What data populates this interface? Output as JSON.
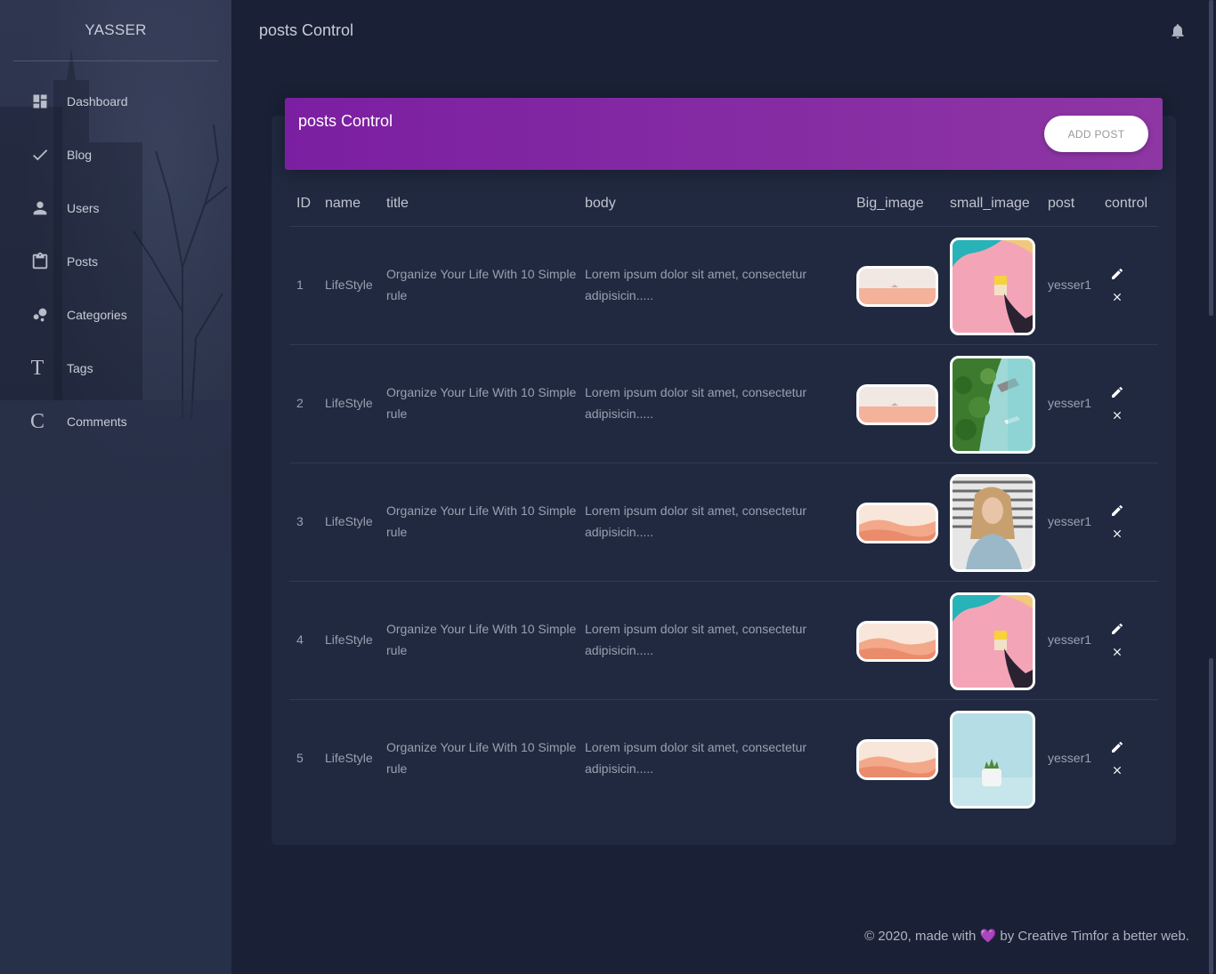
{
  "sidebar": {
    "brand": "YASSER",
    "items": [
      {
        "label": "Dashboard",
        "icon": "dashboard-icon"
      },
      {
        "label": "Blog",
        "icon": "check-icon"
      },
      {
        "label": "Users",
        "icon": "person-icon"
      },
      {
        "label": "Posts",
        "icon": "clipboard-icon"
      },
      {
        "label": "Categories",
        "icon": "bubble-chart-icon"
      },
      {
        "label": "Tags",
        "icon": "letter-t-icon",
        "letter": "T"
      },
      {
        "label": "Comments",
        "icon": "letter-c-icon",
        "letter": "C"
      }
    ]
  },
  "header": {
    "title": "posts Control"
  },
  "card": {
    "title": "posts Control",
    "add_button": "ADD POST",
    "columns": [
      "ID",
      "name",
      "title",
      "body",
      "Big_image",
      "small_image",
      "post",
      "control"
    ],
    "rows": [
      {
        "id": "1",
        "name": "LifeStyle",
        "title": "Organize Your Life With 10 Simple rule",
        "body": "Lorem ipsum dolor sit amet, consectetur adipisicin.....",
        "post": "yesser1",
        "big_image": "beach",
        "small_image": "pink-wall-cup"
      },
      {
        "id": "2",
        "name": "LifeStyle",
        "title": "Organize Your Life With 10 Simple rule",
        "body": "Lorem ipsum dolor sit amet, consectetur adipisicin.....",
        "post": "yesser1",
        "big_image": "beach",
        "small_image": "tropical-island"
      },
      {
        "id": "3",
        "name": "LifeStyle",
        "title": "Organize Your Life With 10 Simple rule",
        "body": "Lorem ipsum dolor sit amet, consectetur adipisicin.....",
        "post": "yesser1",
        "big_image": "desert",
        "small_image": "woman-portrait"
      },
      {
        "id": "4",
        "name": "LifeStyle",
        "title": "Organize Your Life With 10 Simple rule",
        "body": "Lorem ipsum dolor sit amet, consectetur adipisicin.....",
        "post": "yesser1",
        "big_image": "desert",
        "small_image": "pink-wall-cup"
      },
      {
        "id": "5",
        "name": "LifeStyle",
        "title": "Organize Your Life With 10 Simple rule",
        "body": "Lorem ipsum dolor sit amet, consectetur adipisicin.....",
        "post": "yesser1",
        "big_image": "desert",
        "small_image": "plant-pot"
      }
    ]
  },
  "footer": {
    "prefix": "© 2020, made with",
    "heart": "💜",
    "suffix": "by Creative Timfor a better web."
  },
  "colors": {
    "background": "#1a2035",
    "card": "#202940",
    "header_gradient_start": "#7b1fa2",
    "header_gradient_end": "#8e36a4",
    "heart": "#9c27b0"
  }
}
